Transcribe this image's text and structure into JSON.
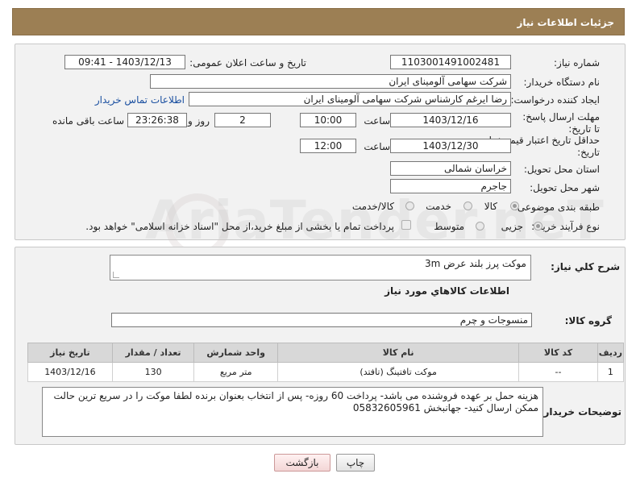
{
  "header": {
    "title": "جزئیات اطلاعات نیاز"
  },
  "form": {
    "need_number": {
      "label": "شماره نیاز:",
      "value": "1103001491002481"
    },
    "announce_datetime": {
      "label": "تاریخ و ساعت اعلان عمومی:",
      "value": "1403/12/13 - 09:41"
    },
    "buyer_org": {
      "label": "نام دستگاه خریدار:",
      "value": "شرکت سهامی آلومینای ایران"
    },
    "requester": {
      "label": "ایجاد کننده درخواست:",
      "value": "رضا ایرغم کارشناس شرکت سهامی آلومینای ایران",
      "contact_link": "اطلاعات تماس خریدار"
    },
    "reply_deadline": {
      "label": "مهلت ارسال پاسخ: تا تاریخ:",
      "date": "1403/12/16",
      "time_label": "ساعت",
      "time": "10:00",
      "days": "2",
      "days_label": "روز و",
      "remaining": "23:26:38",
      "remaining_label": "ساعت باقی مانده"
    },
    "price_validity": {
      "label": "حداقل تاریخ اعتبار قیمت: تا تاریخ:",
      "date": "1403/12/30",
      "time_label": "ساعت",
      "time": "12:00"
    },
    "delivery_province": {
      "label": "استان محل تحویل:",
      "value": "خراسان شمالی"
    },
    "delivery_city": {
      "label": "شهر محل تحویل:",
      "value": "جاجرم"
    },
    "category": {
      "label": "طبقه بندی موضوعی:",
      "options": [
        "کالا",
        "خدمت",
        "کالا/خدمت"
      ],
      "selected": "کالا"
    },
    "purchase_type": {
      "label": "نوع فرآیند خرید :",
      "options": [
        "جزیی",
        "متوسط"
      ],
      "selected": "جزیی",
      "payment_note": "پرداخت تمام یا بخشی از مبلغ خرید،از محل \"اسناد خزانه اسلامی\" خواهد بود."
    }
  },
  "description": {
    "label": "شرح کلي نياز:",
    "value": "موکت پرز بلند عرض 3m"
  },
  "goods_info": {
    "title": "اطلاعات کالاهاي مورد نياز",
    "group_label": "گروه کالا:",
    "group_value": "منسوجات و چرم"
  },
  "table": {
    "headers": [
      "رديف",
      "کد کالا",
      "نام کالا",
      "واحد شمارش",
      "تعداد / مقدار",
      "تاريخ نياز"
    ],
    "rows": [
      [
        "1",
        "--",
        "موکت تافتینگ (تافتد)",
        "متر مربع",
        "130",
        "1403/12/16"
      ]
    ]
  },
  "buyer_notes": {
    "label": "توضيحات خريدار:",
    "value": "هزینه حمل بر عهده فروشنده می باشد- پرداخت 60 روزه- پس از انتخاب بعنوان برنده لطفا موکت را در سریع ترین حالت ممکن ارسال کنید- جهانبخش 05832605961"
  },
  "buttons": {
    "print": "چاپ",
    "back": "بازگشت"
  },
  "watermark": "AriaTender.neT",
  "colors": {
    "header_bg": "#9c7f54",
    "link": "#1a4fa0",
    "panel_bg": "#f2f2f2",
    "table_header": "#d8d8d8"
  }
}
